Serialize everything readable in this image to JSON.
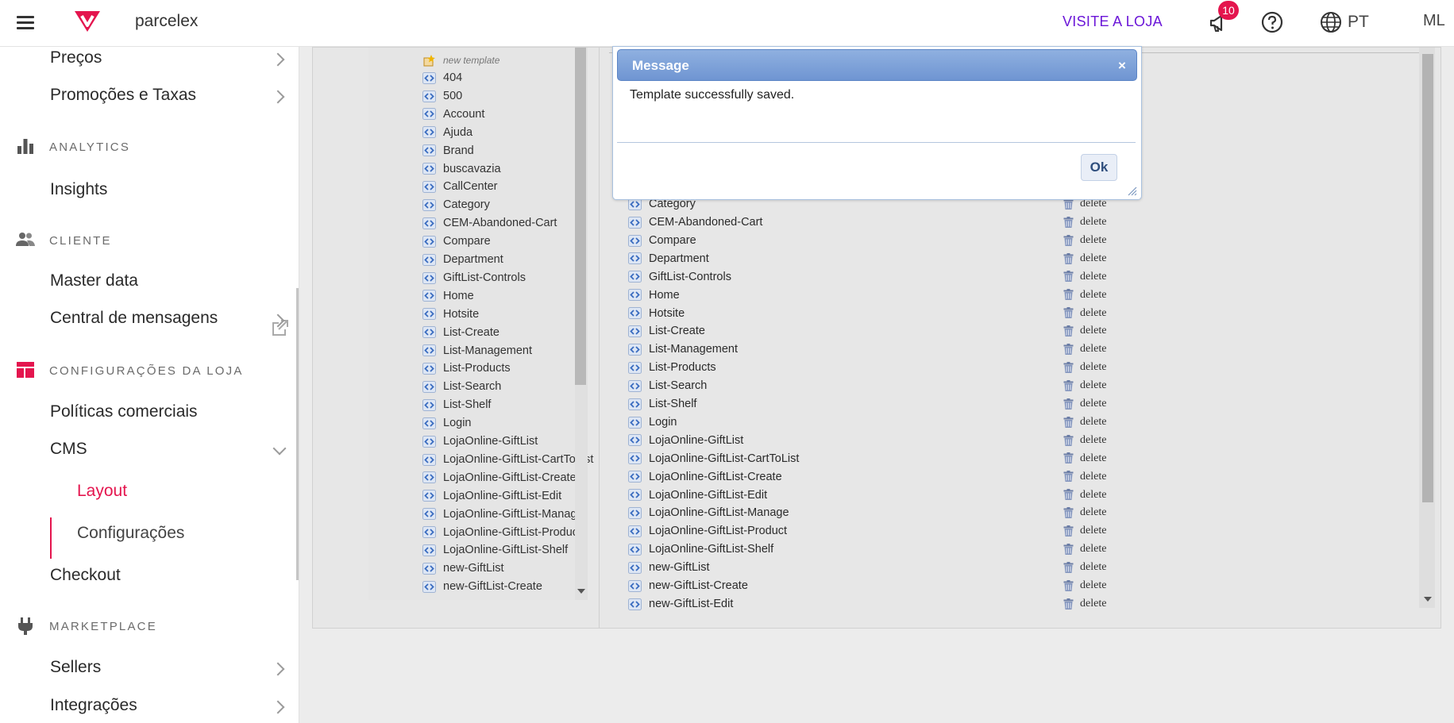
{
  "topbar": {
    "store_name": "parcelex",
    "visit_store": "VISITE A LOJA",
    "notification_count": "10",
    "language": "PT",
    "avatar_initials": "ML",
    "brand_color": "#e4154e"
  },
  "sidebar": {
    "items_top": [
      "Preços",
      "Promoções e Taxas"
    ],
    "sections": {
      "analytics": "ANALYTICS",
      "cliente": "CLIENTE",
      "config": "CONFIGURAÇÕES DA LOJA",
      "marketplace": "MARKETPLACE"
    },
    "insights": "Insights",
    "master_data": "Master data",
    "central": "Central de mensagens",
    "politicas": "Políticas comerciais",
    "cms": "CMS",
    "layout": "Layout",
    "configuracoes": "Configurações",
    "checkout": "Checkout",
    "sellers": "Sellers",
    "integracoes": "Integrações",
    "active_color": "#e4154e"
  },
  "tree": {
    "new_template": "new template",
    "items": [
      "404",
      "500",
      "Account",
      "Ajuda",
      "Brand",
      "buscavazia",
      "CallCenter",
      "Category",
      "CEM-Abandoned-Cart",
      "Compare",
      "Department",
      "GiftList-Controls",
      "Home",
      "Hotsite",
      "List-Create",
      "List-Management",
      "List-Products",
      "List-Search",
      "List-Shelf",
      "Login",
      "LojaOnline-GiftList",
      "LojaOnline-GiftList-CartToList",
      "LojaOnline-GiftList-Create",
      "LojaOnline-GiftList-Edit",
      "LojaOnline-GiftList-Manage",
      "LojaOnline-GiftList-Product",
      "LojaOnline-GiftList-Shelf",
      "new-GiftList",
      "new-GiftList-Create"
    ]
  },
  "list": {
    "delete_label": "delete",
    "partial_row": "Category",
    "items": [
      "CEM-Abandoned-Cart",
      "Compare",
      "Department",
      "GiftList-Controls",
      "Home",
      "Hotsite",
      "List-Create",
      "List-Management",
      "List-Products",
      "List-Search",
      "List-Shelf",
      "Login",
      "LojaOnline-GiftList",
      "LojaOnline-GiftList-CartToList",
      "LojaOnline-GiftList-Create",
      "LojaOnline-GiftList-Edit",
      "LojaOnline-GiftList-Manage",
      "LojaOnline-GiftList-Product",
      "LojaOnline-GiftList-Shelf",
      "new-GiftList",
      "new-GiftList-Create",
      "new-GiftList-Edit"
    ]
  },
  "dialog": {
    "title": "Message",
    "close": "×",
    "message": "Template successfully saved.",
    "ok_label": "Ok"
  }
}
